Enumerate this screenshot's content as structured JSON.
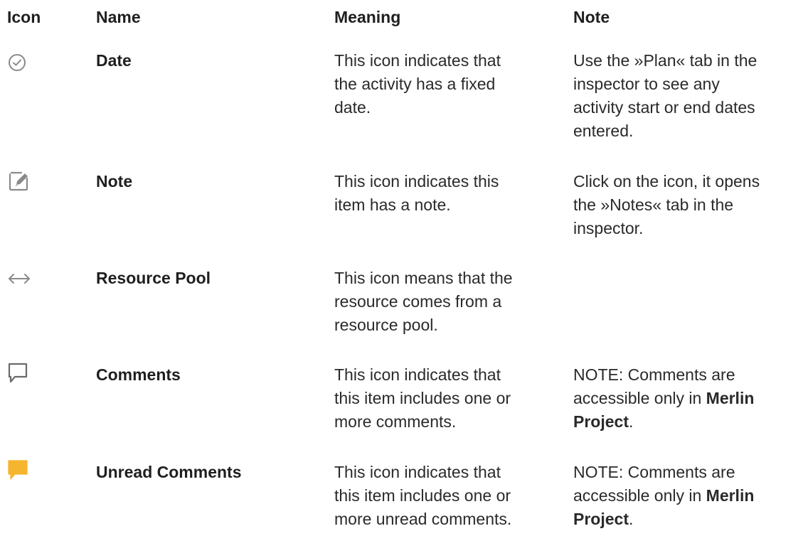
{
  "header": {
    "icon": "Icon",
    "name": "Name",
    "meaning": "Meaning",
    "note": "Note"
  },
  "rows": [
    {
      "icon": "clock-check-icon",
      "name": "Date",
      "meaning_lines": [
        "This icon indicates that",
        "the activity has a fixed",
        "date."
      ],
      "note_lines": [
        "Use the »Plan« tab in the",
        "inspector to see any",
        "activity start or end dates",
        "entered."
      ]
    },
    {
      "icon": "pencil-note-icon",
      "name": "Note",
      "meaning_lines": [
        "This icon indicates this",
        "item has a note."
      ],
      "note_lines": [
        "Click on the icon, it opens",
        "the »Notes« tab in the",
        "inspector."
      ]
    },
    {
      "icon": "double-arrow-icon",
      "name": "Resource Pool",
      "meaning_lines": [
        "This icon means that the",
        "resource comes from a",
        "resource pool."
      ],
      "note_lines": []
    },
    {
      "icon": "comment-bubble-icon",
      "name": "Comments",
      "meaning_lines": [
        "This icon indicates that",
        "this item includes one or",
        "more comments."
      ],
      "note_lines": [
        "NOTE: Comments are",
        "accessible only in"
      ],
      "note_bold_1": "Merlin",
      "note_bold_2": "Project",
      "note_tail": "."
    },
    {
      "icon": "unread-comment-bubble-icon",
      "name": "Unread Comments",
      "meaning_lines": [
        "This icon indicates that",
        "this item includes one or",
        "more unread comments."
      ],
      "note_lines": [
        "NOTE: Comments are",
        "accessible only in"
      ],
      "note_bold_1": "Merlin",
      "note_bold_2": "Project",
      "note_tail": "."
    }
  ],
  "colors": {
    "icon_gray": "#8a8a8a",
    "unread_yellow": "#f5b52e"
  }
}
